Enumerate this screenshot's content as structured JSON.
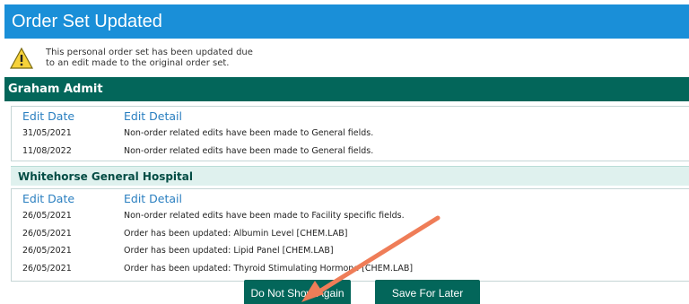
{
  "dialog": {
    "title": "Order Set Updated",
    "notice_line1": "This personal order set has been updated due",
    "notice_line2": "to an edit made to the original order set."
  },
  "group": {
    "name": "Graham Admit"
  },
  "personal_edits": {
    "headers": {
      "date": "Edit Date",
      "detail": "Edit Detail"
    },
    "rows": [
      {
        "date": "31/05/2021",
        "detail": "Non-order related edits have been made to General fields."
      },
      {
        "date": "11/08/2022",
        "detail": "Non-order related edits have been made to General fields."
      }
    ]
  },
  "facility": {
    "name": "Whitehorse General Hospital"
  },
  "facility_edits": {
    "headers": {
      "date": "Edit Date",
      "detail": "Edit Detail"
    },
    "rows": [
      {
        "date": "26/05/2021",
        "detail": "Non-order related edits have been made to Facility specific fields."
      },
      {
        "date": "26/05/2021",
        "detail": "Order has been updated: Albumin Level [CHEM.LAB]"
      },
      {
        "date": "26/05/2021",
        "detail": "Order has been updated: Lipid Panel [CHEM.LAB]"
      },
      {
        "date": "26/05/2021",
        "detail": "Order has been updated: Thyroid Stimulating Hormone [CHEM.LAB]"
      }
    ]
  },
  "buttons": {
    "do_not_show": "Do Not Show Again",
    "save_later": "Save For Later"
  },
  "colors": {
    "title_bg": "#1a8fd8",
    "header_green": "#03665a",
    "sub_bg": "#dff1ee",
    "link_blue": "#2a7fc0",
    "arrow": "#ef7d58"
  }
}
